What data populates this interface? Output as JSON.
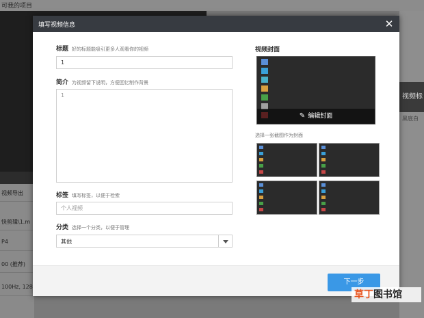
{
  "background": {
    "top_text": "可我的项目",
    "left_rows": [
      "视频导出",
      "快剪辑\\1.m",
      "P4",
      "00 (推荐)",
      "100Hz, 128"
    ],
    "right_button": "视频标",
    "right_sub": "黑底白"
  },
  "dialog": {
    "title": "填写视频信息",
    "close_icon": "close-icon",
    "title_field": {
      "label": "标题",
      "hint": "好的标题能吸引更多人观看你的视频",
      "value": "1"
    },
    "intro_field": {
      "label": "简介",
      "hint": "为视频留下说明，方便回忆制作背景",
      "value": "1"
    },
    "tags_field": {
      "label": "标签",
      "hint": "填写标签，以便于检索",
      "placeholder": "个人视频"
    },
    "category_field": {
      "label": "分类",
      "hint": "选择一个分类，以便于管理",
      "value": "其他"
    },
    "cover": {
      "label": "视频封面",
      "edit_label": "编辑封面",
      "pick_hint": "选择一张截图作为封面"
    },
    "next_button": "下一步"
  },
  "watermark": {
    "highlight": "草丁",
    "rest": "图书馆"
  },
  "colors": {
    "header": "#373b41",
    "primary": "#3a98e6",
    "watermark_accent": "#e8541e"
  }
}
